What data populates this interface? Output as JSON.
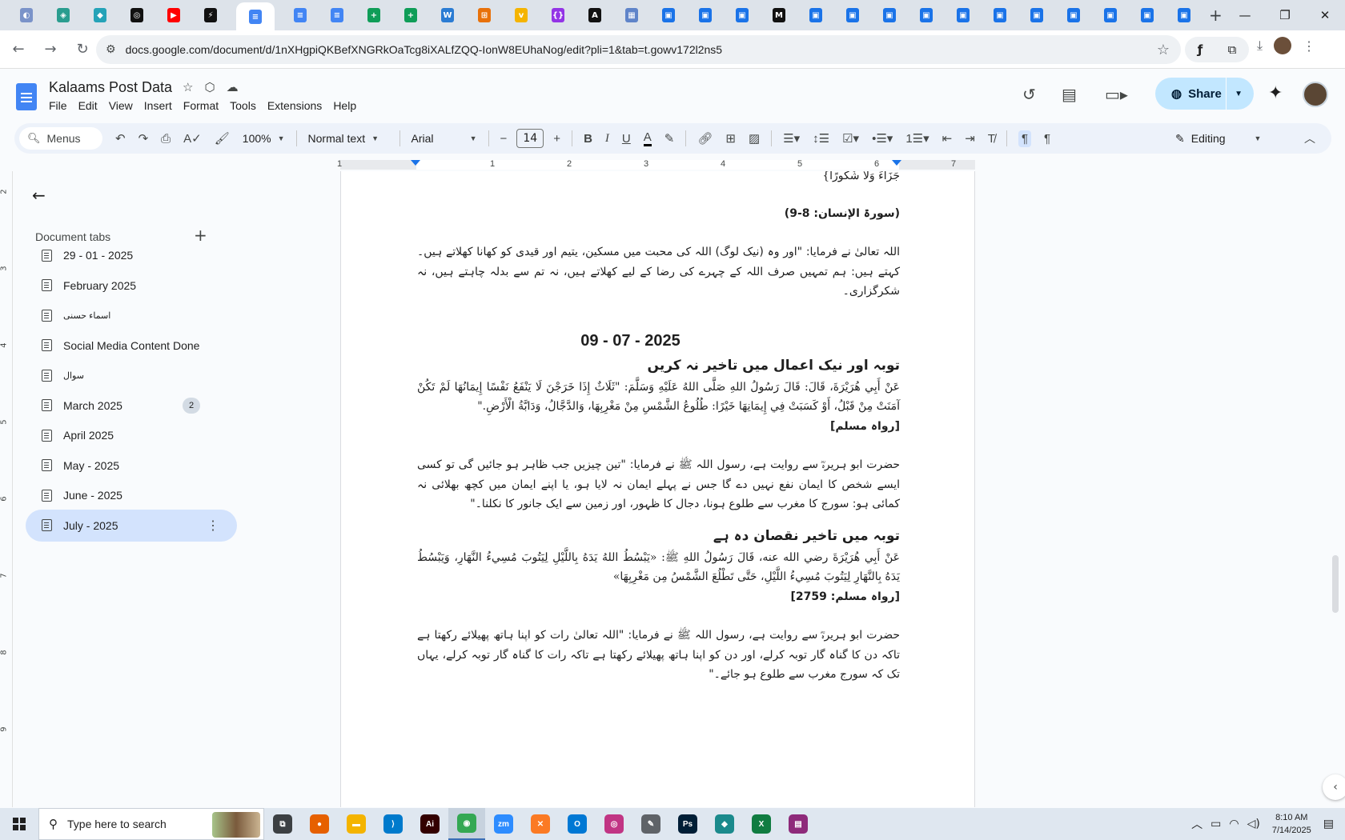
{
  "browser": {
    "tab_icons": [
      {
        "name": "edge-tab-icon",
        "color": "#7a93c9",
        "glyph": "◐"
      },
      {
        "name": "globe-tab-icon",
        "color": "#2a9d8f",
        "glyph": "◈"
      },
      {
        "name": "extension-tab-icon",
        "color": "#25a3b8",
        "glyph": "◆"
      },
      {
        "name": "openai-tab-icon",
        "color": "#111111",
        "glyph": "◎"
      },
      {
        "name": "youtube-tab-icon",
        "color": "#ff0000",
        "glyph": "▶"
      },
      {
        "name": "bolt-tab-icon",
        "color": "#111111",
        "glyph": "⚡"
      },
      {
        "name": "docs-tab-icon",
        "color": "#4285f4",
        "glyph": "≡",
        "active": true
      },
      {
        "name": "docs-tab-icon",
        "color": "#4285f4",
        "glyph": "≡"
      },
      {
        "name": "docs-tab-icon",
        "color": "#4285f4",
        "glyph": "≡"
      },
      {
        "name": "sheets-tab-icon",
        "color": "#0f9d58",
        "glyph": "+"
      },
      {
        "name": "sheets-tab-icon",
        "color": "#0f9d58",
        "glyph": "+"
      },
      {
        "name": "word-tab-icon",
        "color": "#2b7cd3",
        "glyph": "W"
      },
      {
        "name": "grid-tab-icon",
        "color": "#e8710a",
        "glyph": "⊞"
      },
      {
        "name": "v-tab-icon",
        "color": "#f5b400",
        "glyph": "v"
      },
      {
        "name": "code-tab-icon",
        "color": "#9334e6",
        "glyph": "{}"
      },
      {
        "name": "ai-tab-icon",
        "color": "#111111",
        "glyph": "A"
      },
      {
        "name": "image-tab-icon",
        "color": "#5f84c9",
        "glyph": "▦"
      },
      {
        "name": "forms-tab-icon",
        "color": "#1a73e8",
        "glyph": "▣"
      },
      {
        "name": "forms-tab-icon",
        "color": "#1a73e8",
        "glyph": "▣"
      },
      {
        "name": "forms-tab-icon",
        "color": "#1a73e8",
        "glyph": "▣"
      },
      {
        "name": "medium-tab-icon",
        "color": "#111111",
        "glyph": "M"
      },
      {
        "name": "forms-tab-icon",
        "color": "#1a73e8",
        "glyph": "▣"
      },
      {
        "name": "forms-tab-icon",
        "color": "#1a73e8",
        "glyph": "▣"
      },
      {
        "name": "forms-tab-icon",
        "color": "#1a73e8",
        "glyph": "▣"
      },
      {
        "name": "forms-tab-icon",
        "color": "#1a73e8",
        "glyph": "▣"
      },
      {
        "name": "forms-tab-icon",
        "color": "#1a73e8",
        "glyph": "▣"
      },
      {
        "name": "forms-tab-icon",
        "color": "#1a73e8",
        "glyph": "▣"
      },
      {
        "name": "forms-tab-icon",
        "color": "#1a73e8",
        "glyph": "▣"
      },
      {
        "name": "forms-tab-icon",
        "color": "#1a73e8",
        "glyph": "▣"
      },
      {
        "name": "forms-tab-icon",
        "color": "#1a73e8",
        "glyph": "▣"
      },
      {
        "name": "forms-tab-icon",
        "color": "#1a73e8",
        "glyph": "▣"
      },
      {
        "name": "forms-tab-icon",
        "color": "#1a73e8",
        "glyph": "▣"
      }
    ],
    "url": "docs.google.com/document/d/1nXHgpiQKBefXNGRkOaTcg8iXALfZQQ-IonW8EUhaNog/edit?pli=1&tab=t.gowv172l2ns5"
  },
  "doc": {
    "title": "Kalaams Post Data",
    "menu": [
      "File",
      "Edit",
      "View",
      "Insert",
      "Format",
      "Tools",
      "Extensions",
      "Help"
    ],
    "share_label": "Share"
  },
  "toolbar": {
    "menus_label": "Menus",
    "zoom": "100%",
    "style": "Normal text",
    "font": "Arial",
    "font_size": "14",
    "mode": "Editing"
  },
  "ruler": {
    "numbers": [
      "1",
      "1",
      "2",
      "3",
      "4",
      "5",
      "6",
      "7"
    ]
  },
  "sidebar": {
    "title": "Document tabs",
    "tabs": [
      {
        "label": "29 - 01 - 2025"
      },
      {
        "label": "February 2025"
      },
      {
        "label": "اسماء حسنی"
      },
      {
        "label": "Social Media Content Done"
      },
      {
        "label": "سوال"
      },
      {
        "label": "March 2025",
        "badge": "2"
      },
      {
        "label": "April 2025"
      },
      {
        "label": "May - 2025"
      },
      {
        "label": "June - 2025"
      },
      {
        "label": "July - 2025",
        "selected": true
      }
    ]
  },
  "page": {
    "line_top": "جَزَاءً وَلَا شُكُورًا}",
    "surah_ref": "(سورۃ الإنسان: 8-9)",
    "urdu_1": "اللہ تعالیٰ نے فرمایا: \"اور وہ (نیک لوگ) اللہ کی محبت میں مسکین، یتیم اور قیدی کو کھانا کھلاتے ہیں۔ کہتے ہیں: ہم تمہیں صرف اللہ کے چہرے کی رضا کے لیے کھلاتے ہیں، نہ تم سے بدلہ چاہتے ہیں، نہ شکرگزاری۔",
    "date_heading": "09 - 07 - 2025",
    "heading_1": "توبہ اور نیک اعمال میں تاخیر نہ کریں",
    "arabic_1": "عَنْ أَبِي هُرَيْرَةَ، قَالَ: قَالَ رَسُولُ اللهِ صَلَّى اللهُ عَلَيْهِ وَسَلَّمَ: \"ثَلَاثٌ إِذَا خَرَجْنَ لَا يَنْفَعُ نَفْسًا إِيمَانُهَا لَمْ تَكُنْ آمَنَتْ مِنْ قَبْلُ، أَوْ كَسَبَتْ فِي إِيمَانِهَا خَيْرًا: طُلُوعُ الشَّمْسِ مِنْ مَغْرِبِهَا، وَالدَّجَّالُ، وَدَابَّةُ الْأَرْضِ.\"",
    "ref_1": "[رواہ مسلم]",
    "urdu_2": "حضرت ابو ہریرہؓ سے روایت ہے، رسول اللہ ﷺ نے فرمایا: \"تین چیزیں جب ظاہر ہو جائیں گی تو کسی ایسے شخص کا ایمان نفع نہیں دے گا جس نے پہلے ایمان نہ لایا ہو، یا اپنے ایمان میں کچھ بھلائی نہ کمائی ہو: سورج کا مغرب سے طلوع ہونا، دجال کا ظہور، اور زمین سے ایک جانور کا نکلنا۔\"",
    "heading_2": "توبہ میں تاخیر نقصان دہ ہے",
    "arabic_2": "عَنْ أَبِي هُرَيْرَةَ رضي الله عنه، قَالَ رَسُولُ اللهِ ﷺ: «يَبْسُطُ اللهُ يَدَهُ بِاللَّيْلِ لِيَتُوبَ مُسِيءُ النَّهَارِ، وَيَبْسُطُ يَدَهُ بِالنَّهَارِ لِيَتُوبَ مُسِيءُ اللَّيْلِ، حَتَّى تَطْلُعَ الشَّمْسُ مِن مَغْرِبِهَا»",
    "ref_2": "[رواہ مسلم: 2759]",
    "urdu_3": "حضرت ابو ہریرہؓ سے روایت ہے، رسول اللہ ﷺ نے فرمایا: \"اللہ تعالیٰ رات کو اپنا ہاتھ پھیلائے رکھتا ہے تاکہ دن کا گناہ گار توبہ کرلے، اور دن کو اپنا ہاتھ پھیلائے رکھتا ہے تاکہ رات کا گناہ گار توبہ کرلے، یہاں تک کہ سورج مغرب سے طلوع ہو جائے۔\""
  },
  "taskbar": {
    "search_placeholder": "Type here to search",
    "apps": [
      {
        "name": "task-view-icon",
        "color": "#3c4043",
        "glyph": "⧉"
      },
      {
        "name": "firefox-icon",
        "color": "#e66000",
        "glyph": "●"
      },
      {
        "name": "file-explorer-icon",
        "color": "#f4b400",
        "glyph": "▬"
      },
      {
        "name": "vscode-icon",
        "color": "#007acc",
        "glyph": "⟩"
      },
      {
        "name": "illustrator-icon",
        "color": "#330000",
        "glyph": "Ai"
      },
      {
        "name": "chrome-icon",
        "color": "#34a853",
        "glyph": "◉",
        "active": true
      },
      {
        "name": "zoom-icon",
        "color": "#2d8cff",
        "glyph": "zm"
      },
      {
        "name": "xampp-icon",
        "color": "#fb7a24",
        "glyph": "✕"
      },
      {
        "name": "outlook-icon",
        "color": "#0078d4",
        "glyph": "O"
      },
      {
        "name": "affinity-icon",
        "color": "#c13584",
        "glyph": "◎"
      },
      {
        "name": "pen-tool-icon",
        "color": "#5f6368",
        "glyph": "✎"
      },
      {
        "name": "photoshop-icon",
        "color": "#001e36",
        "glyph": "Ps"
      },
      {
        "name": "app-icon",
        "color": "#1b8a8c",
        "glyph": "◆"
      },
      {
        "name": "excel-icon",
        "color": "#107c41",
        "glyph": "X"
      },
      {
        "name": "winrar-icon",
        "color": "#8e2a7a",
        "glyph": "▤"
      }
    ],
    "time": "8:10 AM",
    "date": "7/14/2025"
  }
}
